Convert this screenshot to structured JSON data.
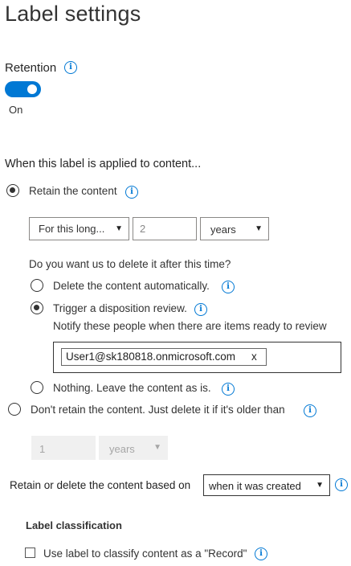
{
  "page": {
    "title": "Label settings"
  },
  "retention": {
    "label": "Retention",
    "state_label": "On",
    "enabled": true
  },
  "applied": {
    "heading": "When this label is applied to content...",
    "retain_label": "Retain the content",
    "duration_select": "For this long...",
    "duration_value": "2",
    "duration_unit": "years",
    "delete_question": "Do you want us to delete it after this time?",
    "opt_delete_auto": "Delete the content automatically.",
    "opt_trigger_review": "Trigger a disposition review.",
    "notify_text": "Notify these people when there are items ready to review",
    "reviewer": "User1@sk180818.onmicrosoft.com",
    "reviewer_remove": "x",
    "opt_nothing": "Nothing. Leave the content as is.",
    "dont_retain_label": "Don't retain the content. Just delete it if it's older than",
    "dont_retain_value": "1",
    "dont_retain_unit": "years",
    "based_on_label": "Retain or delete the content based on",
    "based_on_select": "when it was created"
  },
  "classification": {
    "heading": "Label classification",
    "record_label": "Use label to classify content as a \"Record\""
  },
  "icons": {
    "info": "i",
    "caret": "▼"
  },
  "colors": {
    "accent": "#0078d4"
  }
}
